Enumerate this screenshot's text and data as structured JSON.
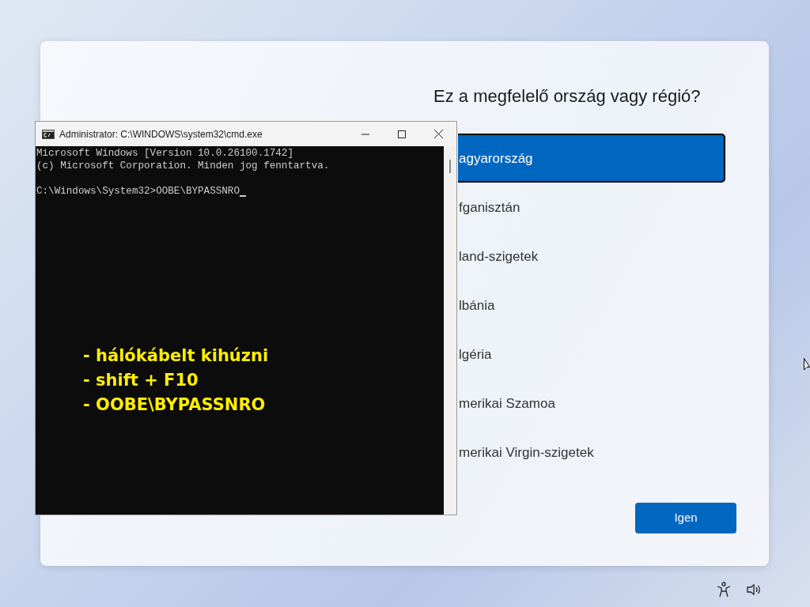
{
  "setup": {
    "title": "Ez a megfelelő ország vagy régió?",
    "regions": [
      {
        "label": "agyarország",
        "selected": true
      },
      {
        "label": "fganisztán",
        "selected": false
      },
      {
        "label": "land-szigetek",
        "selected": false
      },
      {
        "label": "lbánia",
        "selected": false
      },
      {
        "label": "lgéria",
        "selected": false
      },
      {
        "label": "merikai Szamoa",
        "selected": false
      },
      {
        "label": "merikai Virgin-szigetek",
        "selected": false
      }
    ],
    "confirm_button": "Igen"
  },
  "console_window": {
    "title": "Administrator: C:\\WINDOWS\\system32\\cmd.exe",
    "output": [
      "Microsoft Windows [Version 10.0.26100.1742]",
      "(c) Microsoft Corporation. Minden jog fenntartva."
    ],
    "prompt": "C:\\Windows\\System32>OOBE\\BYPASSNRO"
  },
  "annotation": [
    "- hálókábelt kihúzni",
    "- shift + F10",
    "- OOBE\\BYPASSNRO"
  ]
}
